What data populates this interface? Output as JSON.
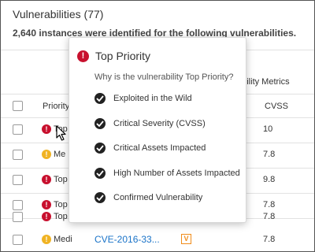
{
  "header": {
    "title": "Vulnerabilities (77)",
    "subtitle": "2,640 instances were identified for the following vulnerabilities."
  },
  "table": {
    "group_header": "ability Metrics",
    "columns": {
      "priority": "Priority",
      "cvss": "CVSS"
    },
    "rows": [
      {
        "priority_level": "high",
        "priority_label": "Top",
        "cvss": "10"
      },
      {
        "priority_level": "medium",
        "priority_label": "Me",
        "cvss": "7.8"
      },
      {
        "priority_level": "high",
        "priority_label": "Top",
        "cvss": "9.8"
      },
      {
        "priority_level": "high",
        "priority_label": "Top",
        "cvss": "7.8"
      },
      {
        "priority_level": "high",
        "priority_label": "Top",
        "cvss": "7.8"
      },
      {
        "priority_level": "medium",
        "priority_label": "Medi",
        "cve": "CVE-2016-33...",
        "badge": "V",
        "cvss": "7.8"
      }
    ]
  },
  "popover": {
    "title": "Top Priority",
    "question": "Why is the vulnerability Top Priority?",
    "reasons": [
      "Exploited in the Wild",
      "Critical Severity (CVSS)",
      "Critical Assets Impacted",
      "High Number of Assets Impacted",
      "Confirmed Vulnerability"
    ]
  },
  "icons": {
    "priority_high": "exclamation-circle-icon",
    "priority_medium": "exclamation-circle-icon",
    "reason_check": "check-circle-icon",
    "cursor": "mouse-pointer-icon"
  },
  "colors": {
    "priority_high": "#c8102e",
    "priority_medium": "#f0b323",
    "link": "#1a73c8",
    "badge": "#f08c1a"
  }
}
